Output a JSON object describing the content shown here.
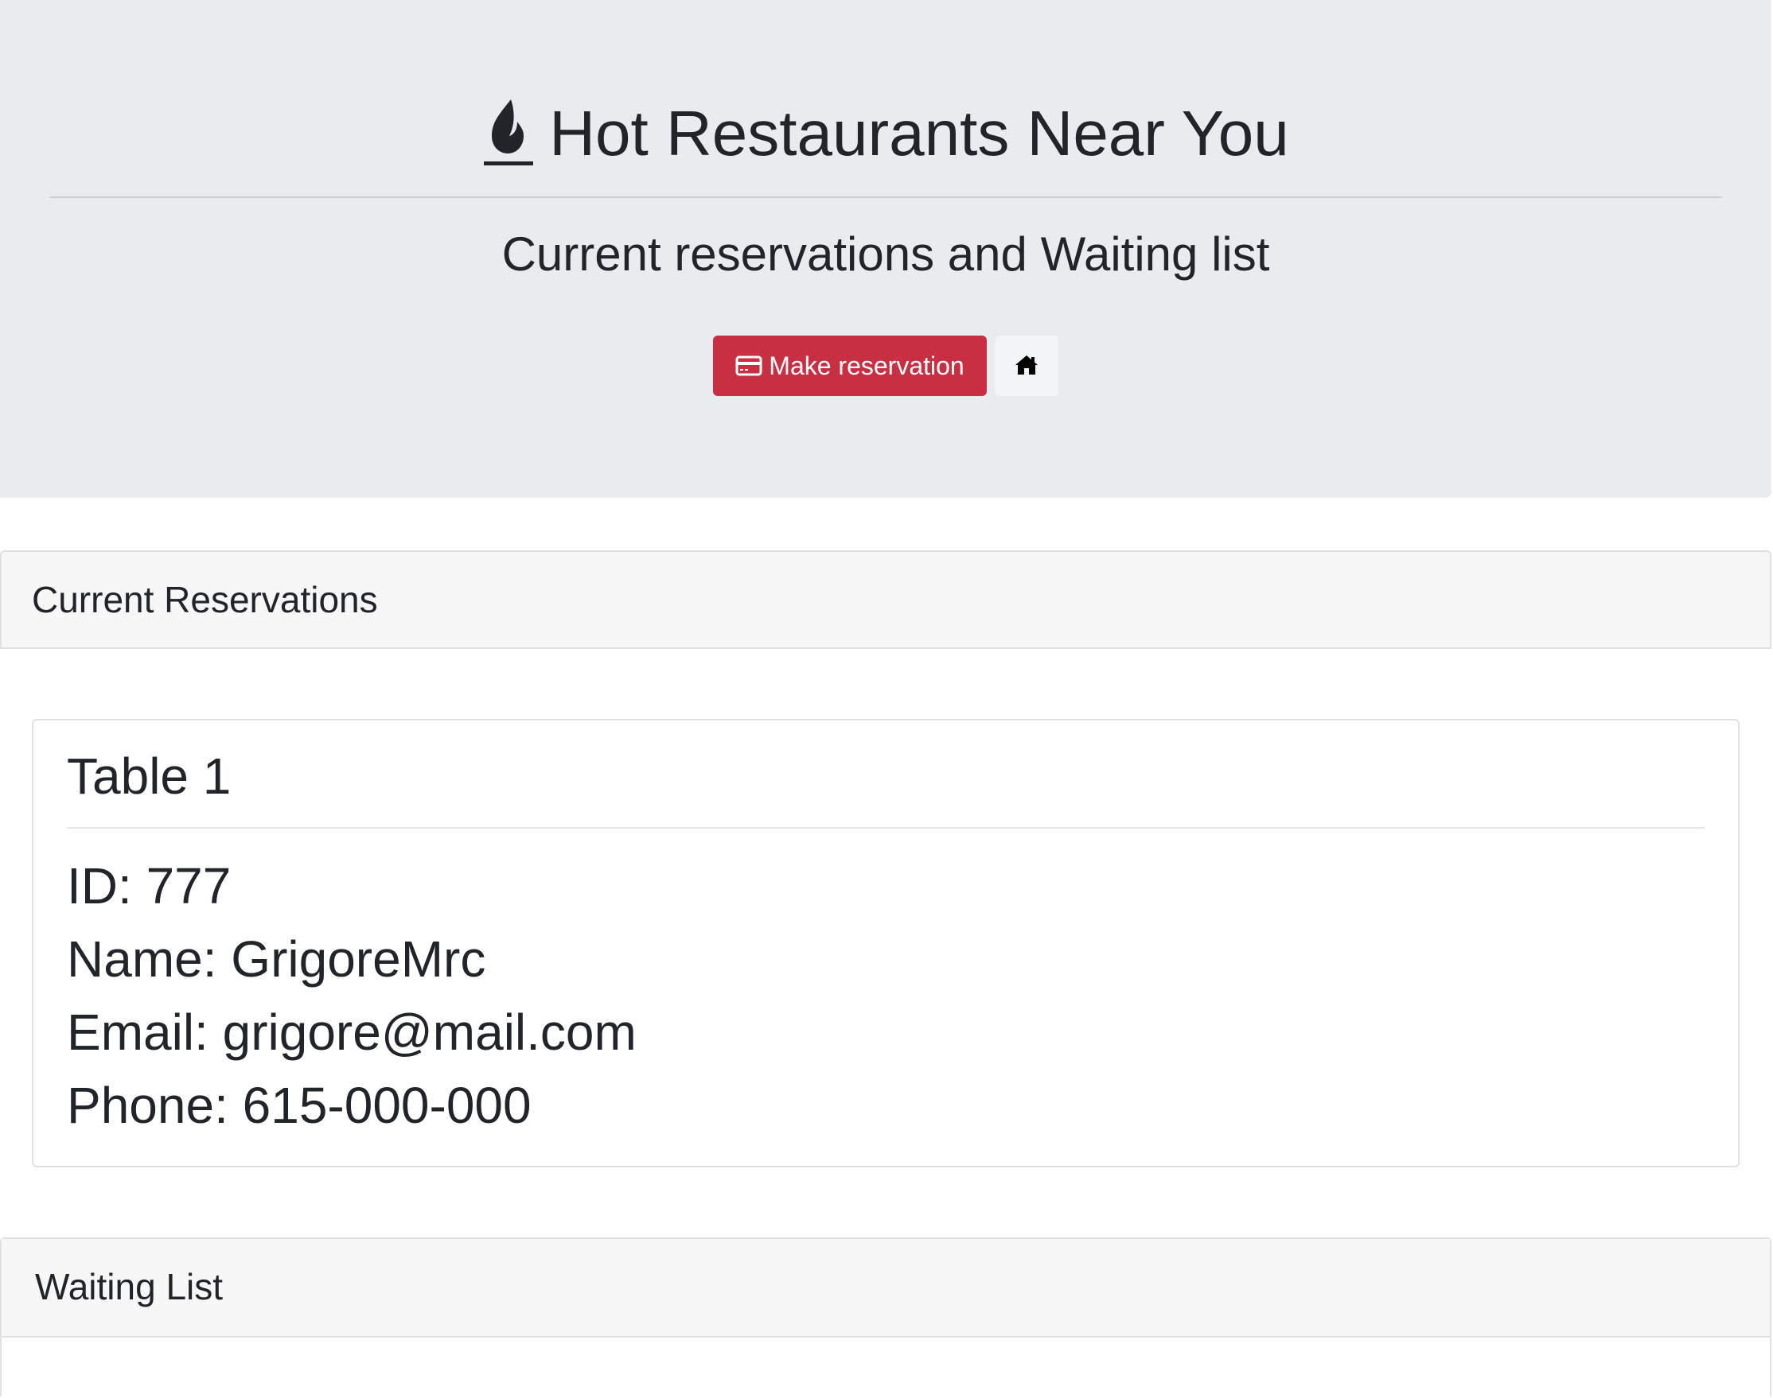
{
  "header": {
    "title": "Hot Restaurants Near You",
    "subtitle": "Current reservations and Waiting list",
    "make_reservation_label": "Make reservation",
    "title_icon": "fire-icon",
    "reservation_icon": "credit-card-icon",
    "home_icon": "home-icon"
  },
  "colors": {
    "jumbotron_bg": "#e9ecef",
    "danger": "#c82f42",
    "text": "#212529",
    "card_header_bg": "#f7f7f7"
  },
  "reservations": {
    "heading": "Current Reservations",
    "tables": [
      {
        "title": "Table 1",
        "id": "ID: 777",
        "name": "Name: GrigoreMrc",
        "email": "Email: grigore@mail.com",
        "phone": "Phone: 615-000-000"
      }
    ]
  },
  "waiting_list": {
    "heading": "Waiting List"
  }
}
